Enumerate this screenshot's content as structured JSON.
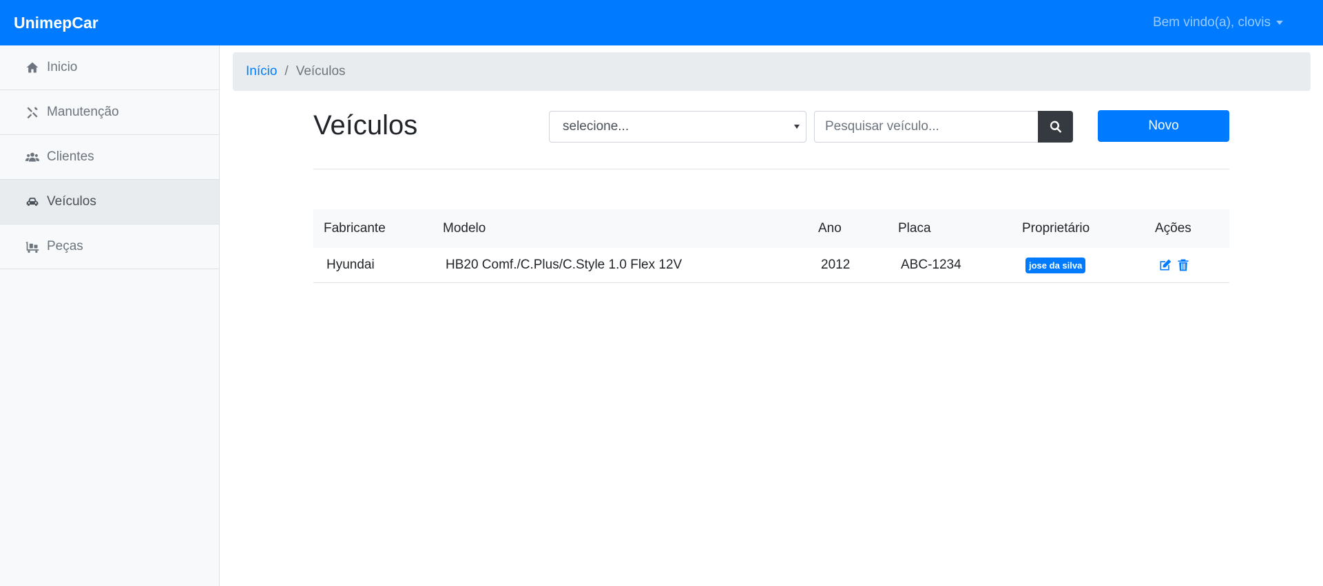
{
  "navbar": {
    "brand": "UnimepCar",
    "user_greeting": "Bem vindo(a), clovis"
  },
  "sidebar": {
    "items": [
      {
        "label": "Inicio",
        "icon": "home-icon",
        "active": false
      },
      {
        "label": "Manutenção",
        "icon": "tools-icon",
        "active": false
      },
      {
        "label": "Clientes",
        "icon": "users-icon",
        "active": false
      },
      {
        "label": "Veículos",
        "icon": "car-icon",
        "active": true
      },
      {
        "label": "Peças",
        "icon": "dolly-icon",
        "active": false
      }
    ]
  },
  "breadcrumb": {
    "home": "Início",
    "separator": "/",
    "current": "Veículos"
  },
  "page": {
    "title": "Veículos",
    "select_value": "selecione...",
    "search_placeholder": "Pesquisar veículo...",
    "new_label": "Novo"
  },
  "table": {
    "headers": [
      "Fabricante",
      "Modelo",
      "Ano",
      "Placa",
      "Proprietário",
      "Ações"
    ],
    "rows": [
      {
        "fabricante": "Hyundai",
        "modelo": "HB20 Comf./C.Plus/C.Style 1.0 Flex 12V",
        "ano": "2012",
        "placa": "ABC-1234",
        "proprietario": "jose da silva"
      }
    ]
  },
  "colors": {
    "primary": "#007bff",
    "dark": "#343a40"
  }
}
